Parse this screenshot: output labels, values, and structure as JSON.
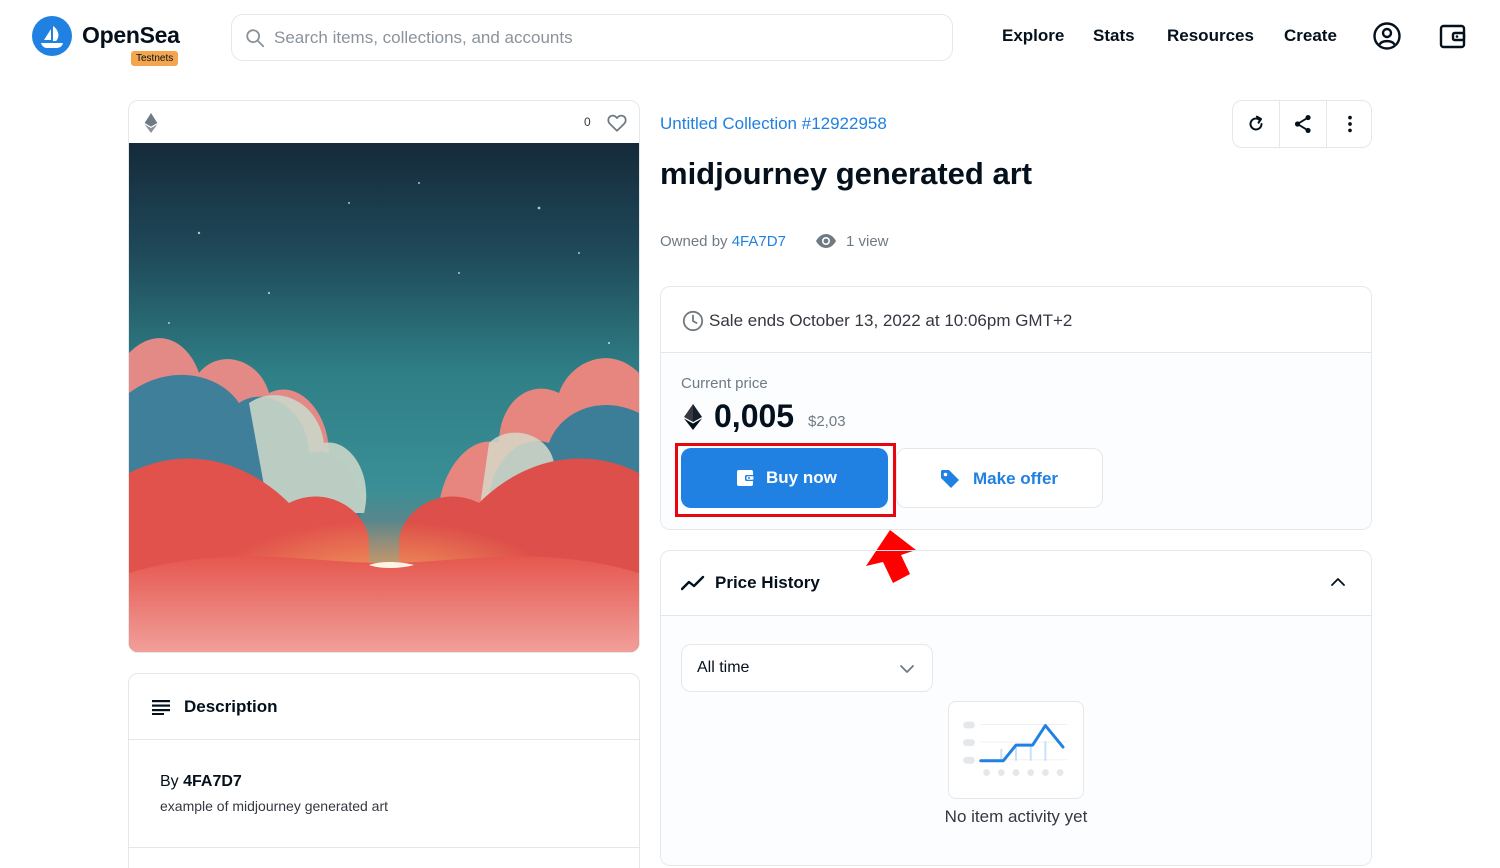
{
  "header": {
    "brand": "OpenSea",
    "badge": "Testnets",
    "search_placeholder": "Search items, collections, and accounts",
    "nav": [
      "Explore",
      "Stats",
      "Resources",
      "Create"
    ],
    "icons": [
      "profile-icon",
      "wallet-icon"
    ]
  },
  "media": {
    "chain_icon": "ethereum-icon",
    "favorites": "0",
    "art_subject": "clouds-sky-artwork"
  },
  "description": {
    "title": "Description",
    "by_prefix": "By",
    "author": "4FA7D7",
    "text": "example of midjourney generated art"
  },
  "item": {
    "collection": "Untitled Collection #12922958",
    "title": "midjourney generated art",
    "owned_by_label": "Owned by",
    "owner": "4FA7D7",
    "views": "1 view"
  },
  "sale": {
    "ends": "Sale ends October 13, 2022 at 10:06pm GMT+2",
    "price_label": "Current price",
    "price": "0,005",
    "fiat": "$2,03",
    "buy_label": "Buy now",
    "offer_label": "Make offer"
  },
  "history": {
    "title": "Price History",
    "range": "All time",
    "empty": "No item activity yet"
  },
  "colors": {
    "accent": "#2081e2",
    "highlight": "#e8060e"
  }
}
